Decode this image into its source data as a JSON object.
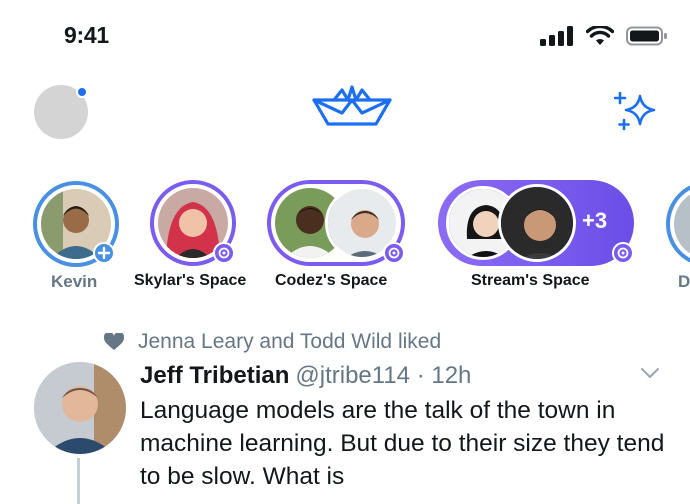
{
  "status_bar": {
    "time": "9:41"
  },
  "colors": {
    "accent": "#1d6ff2",
    "fleet_purple": "#7b5cf0",
    "muted": "#657786"
  },
  "header": {
    "logo_icon": "paper-boat-icon",
    "sparkle_icon": "sparkle-icon"
  },
  "fleet": [
    {
      "label": "Kevin"
    },
    {
      "label": "Skylar's Space"
    },
    {
      "label": "Codez's Space"
    },
    {
      "label": "Stream's Space",
      "more_count": "+3"
    },
    {
      "label": "D"
    }
  ],
  "tweet": {
    "social_context": "Jenna Leary and Todd Wild liked",
    "author_name": "Jeff Tribetian",
    "handle_time": "@jtribe114 · 12h",
    "text": "Language models are the talk of the town in machine learning. But due to their size they tend to be slow. What is"
  }
}
